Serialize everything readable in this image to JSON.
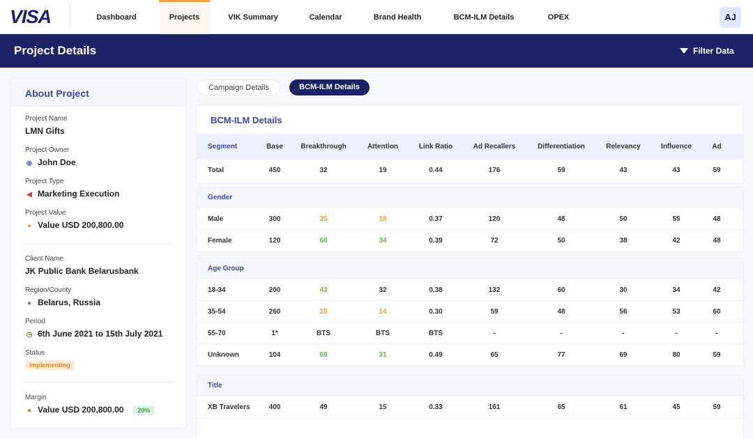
{
  "nav": {
    "logo": "VISA",
    "items": [
      "Dashboard",
      "Projects",
      "VIK Summary",
      "Calendar",
      "Brand Health",
      "BCM-ILM Details",
      "OPEX"
    ],
    "active": "Projects",
    "avatar": "AJ"
  },
  "banner": {
    "title": "Project Details",
    "filter": "Filter Data"
  },
  "about": {
    "title": "About Project",
    "project_name_label": "Project Name",
    "project_name": "LMN Gifts",
    "owner_label": "Project Owner",
    "owner": "John Doe",
    "type_label": "Project Type",
    "type": "Marketing Execution",
    "value_label": "Project Value",
    "value": "Value USD 200,800.00",
    "client_label": "Client Name",
    "client": "JK Public Bank Belarusbank",
    "region_label": "Region/County",
    "region": "Belarus, Russia",
    "period_label": "Period",
    "period": "6th June 2021 to 15th July 2021",
    "status_label": "Status",
    "status": "Implementing",
    "margin_label": "Margin",
    "margin": "Value USD 200,800.00",
    "margin_pct": "20%"
  },
  "tabs": [
    "Campaign Details",
    "BCM-ILM Details"
  ],
  "table": {
    "title": "BCM-ILM Details",
    "columns": [
      "Segment",
      "Base",
      "Breakthrough",
      "Attention",
      "Link Ratio",
      "Ad Recallers",
      "Differentiation",
      "Relevancy",
      "Influence",
      "Ad"
    ],
    "total": [
      "Total",
      "450",
      "32",
      "19",
      "0.44",
      "176",
      "59",
      "43",
      "43",
      "59"
    ],
    "groups": [
      {
        "name": "Gender",
        "rows": [
          [
            "Male",
            "300",
            "35",
            "18",
            "0.37",
            "120",
            "48",
            "50",
            "55",
            "48"
          ],
          [
            "Female",
            "120",
            "68",
            "34",
            "0.39",
            "72",
            "50",
            "38",
            "42",
            "48"
          ]
        ]
      },
      {
        "name": "Age Group",
        "rows": [
          [
            "18-34",
            "200",
            "43",
            "32",
            "0.38",
            "132",
            "60",
            "30",
            "34",
            "42"
          ],
          [
            "35-54",
            "260",
            "25",
            "14",
            "0.30",
            "59",
            "48",
            "56",
            "53",
            "60"
          ],
          [
            "55-70",
            "1*",
            "BTS",
            "BTS",
            "BTS",
            "-",
            "-",
            "-",
            "-",
            "-"
          ],
          [
            "Unknown",
            "104",
            "69",
            "31",
            "0.49",
            "65",
            "77",
            "69",
            "80",
            "59"
          ]
        ]
      },
      {
        "name": "Title",
        "rows": [
          [
            "XB Travelers",
            "400",
            "49",
            "15",
            "0.33",
            "161",
            "65",
            "61",
            "45",
            "59"
          ]
        ]
      }
    ]
  },
  "highlight_colors": {
    "above": "#6cb04a",
    "below": "#e8a13a"
  },
  "highlights": {
    "Male": [
      "o",
      "o"
    ],
    "Female": [
      "g",
      "g"
    ],
    "18-34": [
      "g",
      ""
    ],
    "35-54": [
      "o",
      "o"
    ],
    "Unknown": [
      "g",
      "g"
    ]
  }
}
